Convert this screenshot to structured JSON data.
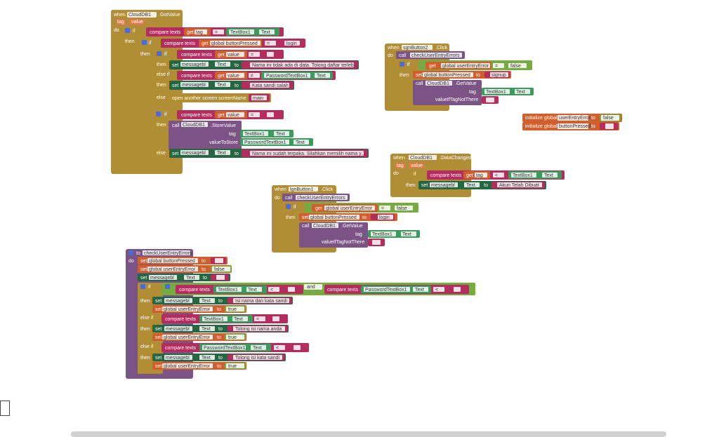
{
  "colors": {
    "control": "#b18e35",
    "procedure": "#7c5385",
    "text": "#b32d5e",
    "component": "#266643",
    "component_light": "#3b9a5c",
    "variable": "#d05f2d",
    "logic": "#77ab41"
  },
  "kw": {
    "when": "when",
    "do": "do",
    "if": "if",
    "then": "then",
    "else": "else",
    "else_if": "else if",
    "set": "set",
    "get": "get",
    "call": "call",
    "to": "to",
    "and": "and",
    "compare_texts": "compare texts",
    "eq": "=",
    "neq": "≠",
    "lt": "<",
    "tag": "tag",
    "value": "value",
    "text": "Text",
    "value_if_tag_not_there": "valueIfTagNotThere",
    "value_to_store": "valueToStore",
    "false": "false",
    "true": "true",
    "initialize_global": "initialize global"
  },
  "b1": {
    "component": "CloudDB1",
    "event": ".GotValue",
    "get_tag": "tag",
    "textbox": "TextBox1",
    "get_btn": "global buttonPressed",
    "login": "login",
    "get_value": "value",
    "label": "messagebl",
    "msg_not_found": "Nama ini tidak ada di data. Tolong daftar terleb...",
    "pwbox": "PasswordTextBox1",
    "msg_wrong": "Kata sandi salah",
    "open_screen": "open another screen  screenName",
    "screen": "main",
    "store": ".StoreValue",
    "msg_taken": "Nama ini sudah terpaka. Silahkan memilih nama y..."
  },
  "b2": {
    "button": "sgnButton2",
    "event": ".Click",
    "proc": "checkUserEntryErrors",
    "get_err": "global userEntryError",
    "set_btn": "global buttonPressed",
    "signup": "signup",
    "db": "CloudDB1",
    "getvalue": ".GetValue",
    "textbox": "TextBox1"
  },
  "b3": {
    "name1": "userEntryError",
    "name2": "buttonPressed"
  },
  "b4": {
    "component": "CloudDB1",
    "event": ".DataChanged",
    "textbox": "TextBox1",
    "label": "messagebl",
    "msg": "Akun Telah Dibuat"
  },
  "b5": {
    "button": "lgnButton1",
    "event": ".Click",
    "proc": "checkUserEntryErrors",
    "get_err": "global userEntryError",
    "set_btn": "global buttonPressed",
    "login": "login",
    "db": "CloudDB1",
    "getvalue": ".GetValue",
    "textbox": "TextBox1"
  },
  "b6": {
    "proc": "checkUserEntryErrors",
    "set_btn": "global buttonPressed",
    "set_err": "global userEntryError",
    "label": "messagebl",
    "textbox": "TextBox1",
    "pwbox": "PasswordTextBox1",
    "msg_both": "Isi nama dan kata sandi",
    "msg_name": "Tolong isi nama anda",
    "msg_pw": "Tolong isi kata sandi"
  }
}
